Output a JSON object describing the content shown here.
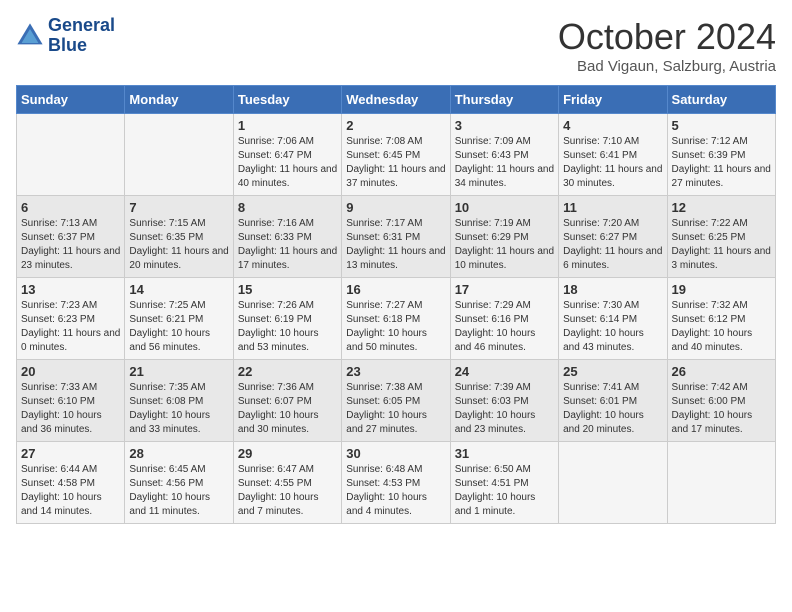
{
  "logo": {
    "line1": "General",
    "line2": "Blue"
  },
  "title": "October 2024",
  "subtitle": "Bad Vigaun, Salzburg, Austria",
  "days_of_week": [
    "Sunday",
    "Monday",
    "Tuesday",
    "Wednesday",
    "Thursday",
    "Friday",
    "Saturday"
  ],
  "weeks": [
    [
      {
        "day": "",
        "info": ""
      },
      {
        "day": "",
        "info": ""
      },
      {
        "day": "1",
        "info": "Sunrise: 7:06 AM\nSunset: 6:47 PM\nDaylight: 11 hours and 40 minutes."
      },
      {
        "day": "2",
        "info": "Sunrise: 7:08 AM\nSunset: 6:45 PM\nDaylight: 11 hours and 37 minutes."
      },
      {
        "day": "3",
        "info": "Sunrise: 7:09 AM\nSunset: 6:43 PM\nDaylight: 11 hours and 34 minutes."
      },
      {
        "day": "4",
        "info": "Sunrise: 7:10 AM\nSunset: 6:41 PM\nDaylight: 11 hours and 30 minutes."
      },
      {
        "day": "5",
        "info": "Sunrise: 7:12 AM\nSunset: 6:39 PM\nDaylight: 11 hours and 27 minutes."
      }
    ],
    [
      {
        "day": "6",
        "info": "Sunrise: 7:13 AM\nSunset: 6:37 PM\nDaylight: 11 hours and 23 minutes."
      },
      {
        "day": "7",
        "info": "Sunrise: 7:15 AM\nSunset: 6:35 PM\nDaylight: 11 hours and 20 minutes."
      },
      {
        "day": "8",
        "info": "Sunrise: 7:16 AM\nSunset: 6:33 PM\nDaylight: 11 hours and 17 minutes."
      },
      {
        "day": "9",
        "info": "Sunrise: 7:17 AM\nSunset: 6:31 PM\nDaylight: 11 hours and 13 minutes."
      },
      {
        "day": "10",
        "info": "Sunrise: 7:19 AM\nSunset: 6:29 PM\nDaylight: 11 hours and 10 minutes."
      },
      {
        "day": "11",
        "info": "Sunrise: 7:20 AM\nSunset: 6:27 PM\nDaylight: 11 hours and 6 minutes."
      },
      {
        "day": "12",
        "info": "Sunrise: 7:22 AM\nSunset: 6:25 PM\nDaylight: 11 hours and 3 minutes."
      }
    ],
    [
      {
        "day": "13",
        "info": "Sunrise: 7:23 AM\nSunset: 6:23 PM\nDaylight: 11 hours and 0 minutes."
      },
      {
        "day": "14",
        "info": "Sunrise: 7:25 AM\nSunset: 6:21 PM\nDaylight: 10 hours and 56 minutes."
      },
      {
        "day": "15",
        "info": "Sunrise: 7:26 AM\nSunset: 6:19 PM\nDaylight: 10 hours and 53 minutes."
      },
      {
        "day": "16",
        "info": "Sunrise: 7:27 AM\nSunset: 6:18 PM\nDaylight: 10 hours and 50 minutes."
      },
      {
        "day": "17",
        "info": "Sunrise: 7:29 AM\nSunset: 6:16 PM\nDaylight: 10 hours and 46 minutes."
      },
      {
        "day": "18",
        "info": "Sunrise: 7:30 AM\nSunset: 6:14 PM\nDaylight: 10 hours and 43 minutes."
      },
      {
        "day": "19",
        "info": "Sunrise: 7:32 AM\nSunset: 6:12 PM\nDaylight: 10 hours and 40 minutes."
      }
    ],
    [
      {
        "day": "20",
        "info": "Sunrise: 7:33 AM\nSunset: 6:10 PM\nDaylight: 10 hours and 36 minutes."
      },
      {
        "day": "21",
        "info": "Sunrise: 7:35 AM\nSunset: 6:08 PM\nDaylight: 10 hours and 33 minutes."
      },
      {
        "day": "22",
        "info": "Sunrise: 7:36 AM\nSunset: 6:07 PM\nDaylight: 10 hours and 30 minutes."
      },
      {
        "day": "23",
        "info": "Sunrise: 7:38 AM\nSunset: 6:05 PM\nDaylight: 10 hours and 27 minutes."
      },
      {
        "day": "24",
        "info": "Sunrise: 7:39 AM\nSunset: 6:03 PM\nDaylight: 10 hours and 23 minutes."
      },
      {
        "day": "25",
        "info": "Sunrise: 7:41 AM\nSunset: 6:01 PM\nDaylight: 10 hours and 20 minutes."
      },
      {
        "day": "26",
        "info": "Sunrise: 7:42 AM\nSunset: 6:00 PM\nDaylight: 10 hours and 17 minutes."
      }
    ],
    [
      {
        "day": "27",
        "info": "Sunrise: 6:44 AM\nSunset: 4:58 PM\nDaylight: 10 hours and 14 minutes."
      },
      {
        "day": "28",
        "info": "Sunrise: 6:45 AM\nSunset: 4:56 PM\nDaylight: 10 hours and 11 minutes."
      },
      {
        "day": "29",
        "info": "Sunrise: 6:47 AM\nSunset: 4:55 PM\nDaylight: 10 hours and 7 minutes."
      },
      {
        "day": "30",
        "info": "Sunrise: 6:48 AM\nSunset: 4:53 PM\nDaylight: 10 hours and 4 minutes."
      },
      {
        "day": "31",
        "info": "Sunrise: 6:50 AM\nSunset: 4:51 PM\nDaylight: 10 hours and 1 minute."
      },
      {
        "day": "",
        "info": ""
      },
      {
        "day": "",
        "info": ""
      }
    ]
  ]
}
